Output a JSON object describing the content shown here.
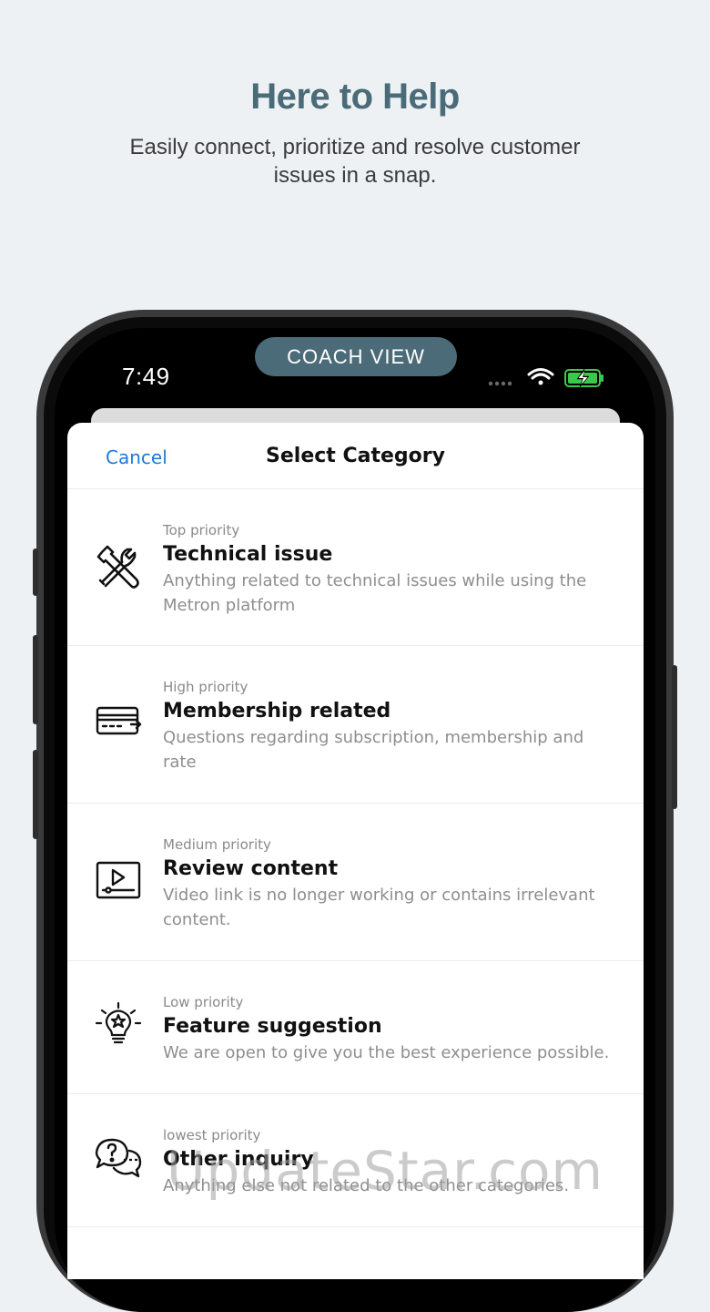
{
  "promo": {
    "headline": "Here to Help",
    "subline": "Easily connect, prioritize and resolve customer issues  in a snap."
  },
  "status_bar": {
    "time": "7:49",
    "mode_pill": "COACH VIEW"
  },
  "sheet": {
    "cancel_label": "Cancel",
    "title": "Select Category",
    "categories": [
      {
        "priority": "Top priority",
        "title": "Technical issue",
        "description": "Anything related to technical issues while using the Metron platform",
        "icon": "tools-icon"
      },
      {
        "priority": "High priority",
        "title": "Membership related",
        "description": "Questions regarding subscription, membership and rate",
        "icon": "credit-card-icon"
      },
      {
        "priority": "Medium priority",
        "title": "Review content",
        "description": "Video link is no longer working or contains irrelevant content.",
        "icon": "video-player-icon"
      },
      {
        "priority": "Low priority",
        "title": "Feature suggestion",
        "description": "We are open to give you the best experience possible.",
        "icon": "lightbulb-icon"
      },
      {
        "priority": "lowest priority",
        "title": "Other inquiry",
        "description": "Anything else not related to the other categories.",
        "icon": "chat-question-icon"
      }
    ]
  },
  "watermark": "UpdateStar.com",
  "colors": {
    "background": "#eef1f4",
    "headline": "#4a6b78",
    "pill": "#4c6b78",
    "link": "#1e7ad6",
    "battery": "#3cc84a"
  }
}
